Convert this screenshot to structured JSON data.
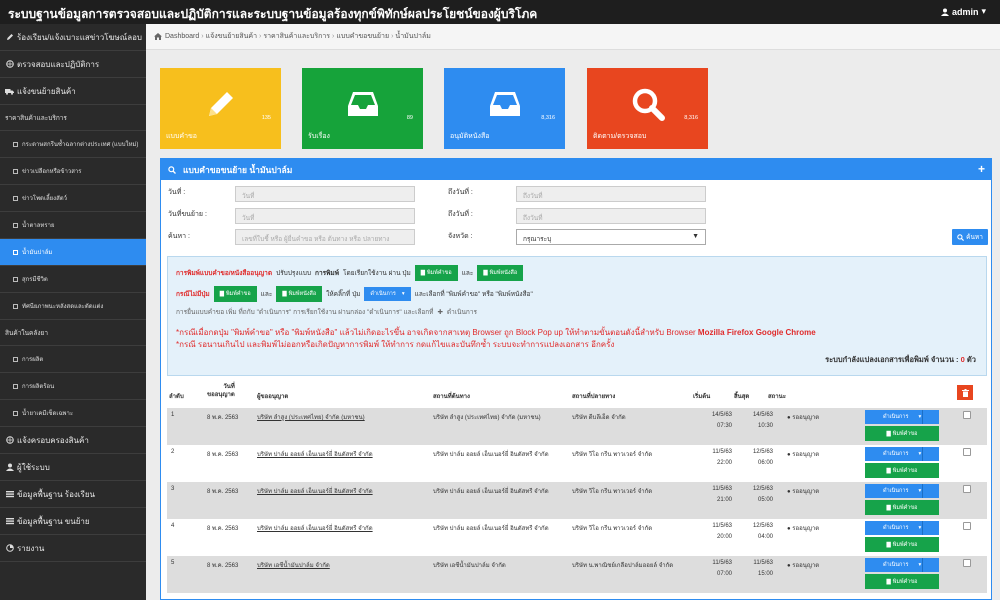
{
  "app": {
    "title": "ระบบฐานข้อมูลการตรวจสอบและปฏิบัติการและระบบฐานข้อมูลร้องทุกข์พิทักษ์ผลประโยชน์ของผู้บริโภค",
    "user": "admin"
  },
  "sidebar": {
    "top_items": [
      {
        "label": "ร้องเรียน/แจ้งเบาะแสข่าวโฆษณ์ลอบ",
        "icon": "edit-icon"
      },
      {
        "label": "ตรวจสอบและปฏิบัติการ",
        "icon": "globe-icon"
      },
      {
        "label": "แจ้งขนย้ายสินค้า",
        "icon": "truck-icon"
      }
    ],
    "section1": "ราคาสินค้าและบริการ",
    "sub_items1": [
      "กระดาษสกรีนซ้ำฉลากต่างประเทศ (แบบใหม่)",
      "ข่าวเปลือกหรือข้าวสาร",
      "ข่าวโพดเลี้ยงสัตว์",
      "น้ำตาลทราย",
      "น้ำมันปาล์ม",
      "สุกรมีชีวิต",
      "ทัศนียภาพนะหลังสดและตัดแต่ง"
    ],
    "section2": "สินค้าในคลังยา",
    "sub_items2": [
      "การผลิต",
      "การผลิตร้อน",
      "น้ำยาเคมีเช็ดเฉพาะ"
    ],
    "bottom_items": [
      {
        "label": "แจ้งครอบครองสินค้า",
        "icon": "globe-icon"
      },
      {
        "label": "ผู้ใช้ระบบ",
        "icon": "user-icon"
      },
      {
        "label": "ข้อมูลพื้นฐาน ร้องเรียน",
        "icon": "list-icon"
      },
      {
        "label": "ข้อมูลพื้นฐาน ขนย้าย",
        "icon": "list-icon"
      },
      {
        "label": "รายงาน",
        "icon": "chart-icon"
      }
    ]
  },
  "breadcrumb": [
    "Dashboard",
    "แจ้งขนย้ายสินค้า",
    "ราคาสินค้าและบริการ",
    "แบบคำขอขนย้าย",
    "น้ำมันปาล์ม"
  ],
  "tiles": [
    {
      "label": "แบบคำขอ",
      "count": "135",
      "color": "#f7bf1d",
      "icon": "pencil-icon"
    },
    {
      "label": "รับเรื่อง",
      "count": "89",
      "color": "#16a33a",
      "icon": "inbox-icon"
    },
    {
      "label": "อนุมัติหนังสือ",
      "count": "8,316",
      "color": "#2e8cf0",
      "icon": "inbox-icon"
    },
    {
      "label": "ติดตาม/ตรวจสอบ",
      "count": "8,316",
      "color": "#e8461f",
      "icon": "search-icon"
    }
  ],
  "panel": {
    "title": "แบบคำขอขนย้าย น้ำมันปาล์ม",
    "form": {
      "date_label": "วันที่ :",
      "date_ph": "วันที่",
      "to_date_label": "ถึงวันที่ :",
      "to_date_ph": "ถึงวันที่",
      "move_date_label": "วันที่ขนย้าย :",
      "move_date_ph": "วันที่",
      "to_move_date_label": "ถึงวันที่ :",
      "to_move_date_ph": "ถึงวันที่",
      "search_label": "ค้นหา :",
      "search_ph": "เลขที่ใบชี้ หรือ ผู้ยื่นคำขอ หรือ ต้นทาง หรือ ปลายทาง",
      "province_label": "จังหวัด :",
      "province_value": "กรุณาระบุ",
      "search_button": "ค้นหา"
    },
    "info": {
      "line1_a": "การพิมพ์แบบคำขอ/หนังสืออนุญาต",
      "line1_b": "ปรับปรุงแบบ",
      "line1_c": "การพิมพ์",
      "line1_d": "โดยเรียกใช้งาน ผ่าน ปุ่ม",
      "btn_print_form": "พิมพ์คำขอ",
      "and": "และ",
      "btn_print_letter": "พิมพ์หนังสือ",
      "line2_a": "กรณีไม่มีปุ่ม",
      "line2_b": "ให้คลิ๊กที่ ปุ่ม",
      "btn_operate": "ดำเนินการ",
      "line2_c": "และเลือกที่ \"พิมพ์คำขอ\" หรือ \"พิมพ์หนังสือ\"",
      "line3": "การยื่นแบบคำขอ เพิ่ม ที่ถกับ \"ดำเนินการ\" การเรียกใช้งาน ผ่านกล่อง \"ดำเนินการ\" และเลือกที่",
      "line3_b": "ดำเนินการ",
      "msg1_a": "*กรณีเมื่อกดปุ่ม \"พิมพ์คำขอ\" หรือ \"พิมพ์หนังสือ\" แล้วไม่เกิดอะไรขึ้น อาจเกิดจากสาเหตุ Browser ถูก Block Pop up ให้ทำตามขั้นตอนดังนี้สำหรับ Browser",
      "msg1_b": "Mozilla Firefox Google Chrome",
      "msg2": "*กรณี รอนานเกินไป และพิมพ์ไม่ออกหรือเกิดปัญหาการพิมพ์ ให้ทำการ กดแก้ไขและบันทึกซ้ำ ระบบจะทำการแปลงเอกสาร อีกครั้ง",
      "queue_label": "ระบบกำลังแปลงเอกสารเพื่อพิมพ์ จำนวน :",
      "queue_count": "0",
      "queue_unit": "ตัว"
    },
    "table": {
      "headers": {
        "no": "ลำดับ",
        "date": "วันที่\nขออนุญาต",
        "applicant": "ผู้ขออนุญาต",
        "source": "สถานที่ต้นทาง",
        "dest": "สถานที่ปลายทาง",
        "start": "เริ่มต้น",
        "end": "สิ้นสุด",
        "status": "สถานะ"
      },
      "action_label": "ดำเนินการ",
      "print_label": "พิมพ์คำขอ",
      "rows": [
        {
          "no": "1",
          "date": "8 พ.ค. 2563",
          "applicant": "บริษัท ลำสูง (ประเทศไทย) จำกัด (มหาชน)",
          "source": "บริษัท ลำสูง (ประเทศไทย) จำกัด (มหาชน)",
          "dest": "บริษัท ดีบลีเอ็ด จำกัด",
          "start_date": "14/5/63",
          "start_time": "07:30",
          "end_date": "14/5/63",
          "end_time": "10:30",
          "status": "รออนุญาต"
        },
        {
          "no": "2",
          "date": "8 พ.ค. 2563",
          "applicant": "บริษัท ปาล์ม ออยล์ เอ็นเนอร์ยี่ อินดัสทรี จำกัด",
          "source": "บริษัท ปาล์ม ออยล์ เอ็นเนอร์ยี่ อินดัสทรี จำกัด",
          "dest": "บริษัท วีโอ กรีน พาวเวอร์ จำกัด",
          "start_date": "11/5/63",
          "start_time": "22:00",
          "end_date": "12/5/63",
          "end_time": "06:00",
          "status": "รออนุญาต"
        },
        {
          "no": "3",
          "date": "8 พ.ค. 2563",
          "applicant": "บริษัท ปาล์ม ออยล์ เอ็นเนอร์ยี่ อินดัสทรี จำกัด",
          "source": "บริษัท ปาล์ม ออยล์ เอ็นเนอร์ยี่ อินดัสทรี จำกัด",
          "dest": "บริษัท วีโอ กรีน พาวเวอร์ จำกัด",
          "start_date": "11/5/63",
          "start_time": "21:00",
          "end_date": "12/5/63",
          "end_time": "05:00",
          "status": "รออนุญาต"
        },
        {
          "no": "4",
          "date": "8 พ.ค. 2563",
          "applicant": "บริษัท ปาล์ม ออยล์ เอ็นเนอร์ยี่ อินดัสทรี จำกัด",
          "source": "บริษัท ปาล์ม ออยล์ เอ็นเนอร์ยี่ อินดัสทรี จำกัด",
          "dest": "บริษัท วีโอ กรีน พาวเวอร์ จำกัด",
          "start_date": "11/5/63",
          "start_time": "20:00",
          "end_date": "12/5/63",
          "end_time": "04:00",
          "status": "รออนุญาต"
        },
        {
          "no": "5",
          "date": "8 พ.ค. 2563",
          "applicant": "บริษัท เอชีน้ำมันปาล์ม จำกัด",
          "source": "บริษัท เอชีน้ำมันปาล์ม จำกัด",
          "dest": "บริษัท น.พาณิชย์เกลือปาล์มออยล์ จำกัด",
          "start_date": "11/5/63",
          "start_time": "07:00",
          "end_date": "11/5/63",
          "end_time": "15:00",
          "status": "รออนุญาต"
        }
      ]
    }
  }
}
